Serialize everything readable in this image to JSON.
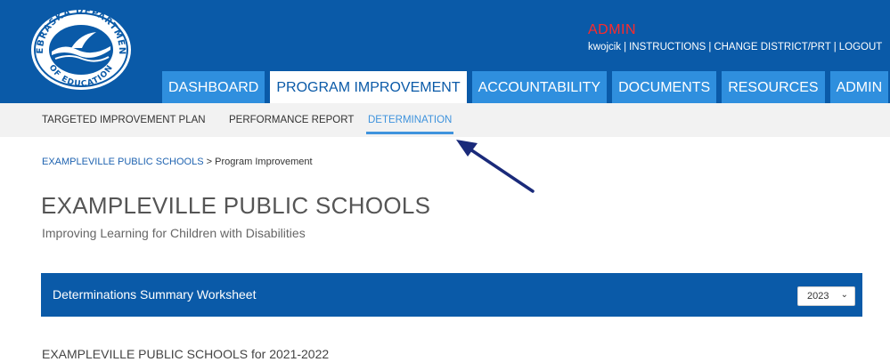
{
  "header": {
    "logo_text_top": "NEBRASKA DEPARTMENT",
    "logo_text_bottom": "OF EDUCATION",
    "role_label": "ADMIN",
    "user": "kwojcik",
    "links": [
      "INSTRUCTIONS",
      "CHANGE DISTRICT/PRT",
      "LOGOUT"
    ],
    "separator": "|"
  },
  "nav": {
    "tabs": [
      {
        "label": "DASHBOARD",
        "active": false
      },
      {
        "label": "PROGRAM IMPROVEMENT",
        "active": true
      },
      {
        "label": "ACCOUNTABILITY",
        "active": false
      },
      {
        "label": "DOCUMENTS",
        "active": false
      },
      {
        "label": "RESOURCES",
        "active": false
      },
      {
        "label": "ADMIN",
        "active": false
      }
    ]
  },
  "subnav": {
    "items": [
      {
        "label": "TARGETED IMPROVEMENT PLAN",
        "active": false
      },
      {
        "label": "PERFORMANCE REPORT",
        "active": false
      },
      {
        "label": "DETERMINATION",
        "active": true
      }
    ]
  },
  "breadcrumb": {
    "link": "EXAMPLEVILLE PUBLIC SCHOOLS",
    "separator": ">",
    "current": "Program Improvement"
  },
  "page": {
    "title": "EXAMPLEVILLE PUBLIC SCHOOLS",
    "subtitle": "Improving Learning for Children with Disabilities"
  },
  "panel": {
    "title": "Determinations Summary Worksheet",
    "year_selected": "2023"
  },
  "section": {
    "heading": "EXAMPLEVILLE PUBLIC SCHOOLS for 2021-2022"
  },
  "colors": {
    "brand_blue": "#0a5aa8",
    "tab_blue": "#2f8fde",
    "admin_red": "#ff2a2a",
    "accent_light_blue": "#3f93dd",
    "annotation_arrow": "#1a2a7a"
  }
}
